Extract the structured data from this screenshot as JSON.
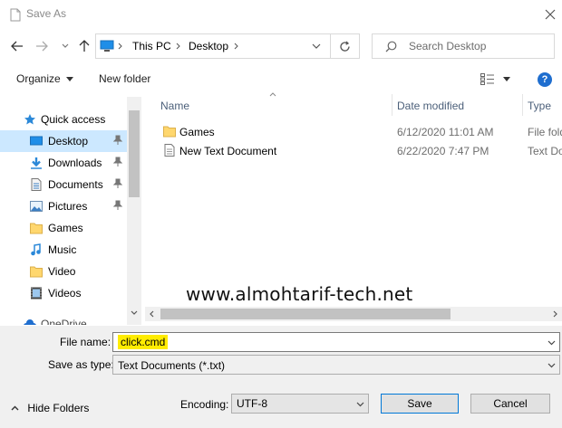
{
  "window": {
    "title": "Save As"
  },
  "navigation": {
    "breadcrumb": [
      "This PC",
      "Desktop"
    ],
    "search_placeholder": "Search Desktop"
  },
  "toolbar": {
    "organize_label": "Organize",
    "new_folder_label": "New folder",
    "help_label": "?"
  },
  "nav_pane": {
    "items": [
      {
        "label": "Quick access",
        "icon": "star-icon",
        "pinned": false
      },
      {
        "label": "Desktop",
        "icon": "desktop-icon",
        "pinned": true,
        "selected": true
      },
      {
        "label": "Downloads",
        "icon": "download-icon",
        "pinned": true
      },
      {
        "label": "Documents",
        "icon": "document-icon",
        "pinned": true
      },
      {
        "label": "Pictures",
        "icon": "picture-icon",
        "pinned": true
      },
      {
        "label": "Games",
        "icon": "folder-icon",
        "pinned": false
      },
      {
        "label": "Music",
        "icon": "music-icon",
        "pinned": false
      },
      {
        "label": "Video",
        "icon": "folder-icon",
        "pinned": false
      },
      {
        "label": "Videos",
        "icon": "video-icon",
        "pinned": false
      },
      {
        "label": "OneDrive",
        "icon": "cloud-icon",
        "pinned": false
      }
    ]
  },
  "file_list": {
    "columns": [
      "Name",
      "Date modified",
      "Type"
    ],
    "rows": [
      {
        "name": "Games",
        "date": "6/12/2020 11:01 AM",
        "type": "File fold",
        "icon": "folder-icon"
      },
      {
        "name": "New Text Document",
        "date": "6/22/2020 7:47 PM",
        "type": "Text Doc",
        "icon": "text-file-icon"
      }
    ]
  },
  "watermark": "www.almohtarif-tech.net",
  "form": {
    "file_name_label": "File name:",
    "file_name_value": "click.cmd",
    "save_type_label": "Save as type:",
    "save_type_value": "Text Documents (*.txt)",
    "encoding_label": "Encoding:",
    "encoding_value": "UTF-8"
  },
  "footer": {
    "hide_folders_label": "Hide Folders",
    "save_label": "Save",
    "cancel_label": "Cancel"
  },
  "colors": {
    "selected_bg": "#cce8ff",
    "highlight": "#ffec00",
    "accent": "#0078d7"
  }
}
